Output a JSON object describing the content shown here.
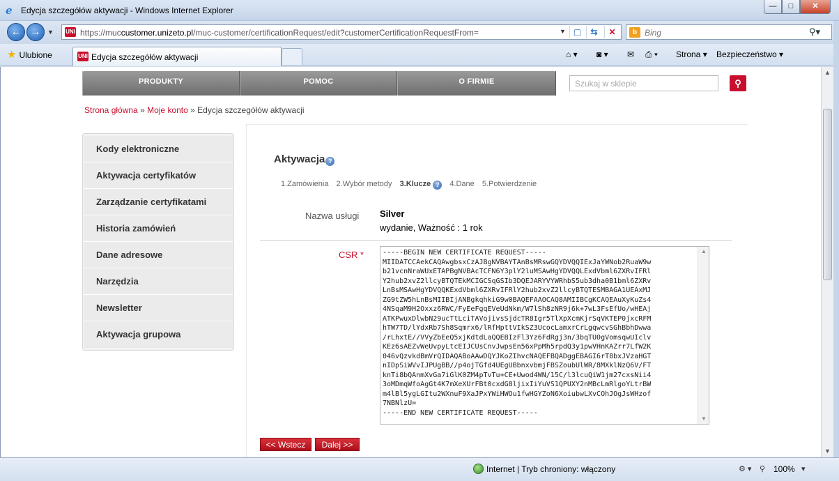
{
  "window": {
    "title": "Edycja szczegółów aktywacji - Windows Internet Explorer",
    "min_label": "—",
    "max_label": "□",
    "close_label": "✕"
  },
  "address_bar": {
    "url_prefix": "https://muc",
    "url_domain": "customer.unizeto.pl",
    "url_path": "/muc-customer/certificationRequest/edit?customerCertificationRequestFrom=",
    "search_placeholder": "Bing",
    "site_icon_text": "UNI"
  },
  "favorites_bar": {
    "favorites_label": "Ulubione",
    "tab_title": "Edycja szczegółów aktywacji",
    "page_menu": "Strona",
    "safety_menu": "Bezpieczeństwo"
  },
  "site_nav": {
    "items": [
      "PRODUKTY",
      "POMOC",
      "O FIRMIE"
    ],
    "search_placeholder": "Szukaj w sklepie"
  },
  "breadcrumb": {
    "home": "Strona główna",
    "separator": "»",
    "account": "Moje konto",
    "current": "Edycja szczegółów aktywacji"
  },
  "sidebar": {
    "items": [
      "Kody elektroniczne",
      "Aktywacja certyfikatów",
      "Zarządzanie certyfikatami",
      "Historia zamówień",
      "Dane adresowe",
      "Narzędzia",
      "Newsletter",
      "Aktywacja grupowa"
    ]
  },
  "main": {
    "heading": "Aktywacja",
    "steps": [
      "1.Zamówienia",
      "2.Wybór metody",
      "3.Klucze",
      "4.Dane",
      "5.Potwierdzenie"
    ],
    "current_step": "3.Klucze",
    "service_label": "Nazwa usługi",
    "service_name": "Silver",
    "service_desc": "wydanie, Ważność : 1 rok",
    "csr_label": "CSR *",
    "csr_lines": [
      "-----BEGIN NEW CERTIFICATE REQUEST-----",
      "MIIDATCCAekCAQAwgbsxCzAJBgNVBAYTAnBsMRswGQYDVQQIExJaYWNob2RuaW9w",
      "b21vcnNraWUxETAPBgNVBAcTCFN6Y3plY2luMSAwHgYDVQQLExdVbml6ZXRvIFRl",
      "Y2hub2xvZ2llcyBTQTEkMCIGCSqGSIb3DQEJARYVYWRhbS5ub3dha0B1bml6ZXRv",
      "LnBsMSAwHgYDVQQKExdVbml6ZXRvIFRlY2hub2xvZ2llcyBTQTESMBAGA1UEAxMJ",
      "ZG9tZW5hLnBsMIIBIjANBgkqhkiG9w0BAQEFAAOCAQ8AMIIBCgKCAQEAuXyKuZs4",
      "4NSqaM9H2Oxxz6RWC/FyEeFgqEVeUdNkm/W7lSh8zNR9j6k+7wL3FsEfUo/wHEAj",
      "ATKPwuxDlwbN29ucTtLciTAVojivsSjdcTR8Igr5TlXpXcmKjrSqVKTEP0jxcRFM",
      "hTW7TD/lYdxRb7Sh8Sqmrx6/lRfHpttVIkSZ3UcocLamxrCrLgqwcvSGhBbhDwwa",
      "/rLhxtE//VVyZbEeQ5xjKdtdLaQQEBIzFl3Yz6FdRgj3n/3bqTU0gVomsqwUIclv",
      "KEz6sAEZvWeUvpyLtcEIJCUsCnvJwpsEn56xPpMh5rpdQ3y1pwVHnKAZrr7LfW2K",
      "046vQzvkdBmVrQIDAQABoAAwDQYJKoZIhvcNAQEFBQADggEBAGI6rT8bxJVzaHGT",
      "nIDpSiWVvIJPUgBB//p4ojTGfd4UEgUBbnxvbmjFBSZoubUlWR/8MXklNzQ6V/FT",
      "knTi8bQAnmXvGa7iGlK0ZM4pTvTu+CE+Uwod4WN/15C/l3lcuQiW1jm27cxsNii4",
      "3oMDmqWfoAgGt4K7mXeXUrFBt0cxdG8ljixIiYuVS1QPUXY2nMBcLmRlgoYLtrBW",
      "m4lBl5ygLGItu2WXnuF9XaJPxYWiHWOu1fwHGYZoN6XoiubwLXvCOhJOgJsWHzof",
      "7NBNlzU=",
      "-----END NEW CERTIFICATE REQUEST-----"
    ],
    "back_button": "<< Wstecz",
    "next_button": "Dalej >>"
  },
  "status_bar": {
    "zone": "Internet | Tryb chroniony: włączony",
    "zoom": "100%"
  }
}
